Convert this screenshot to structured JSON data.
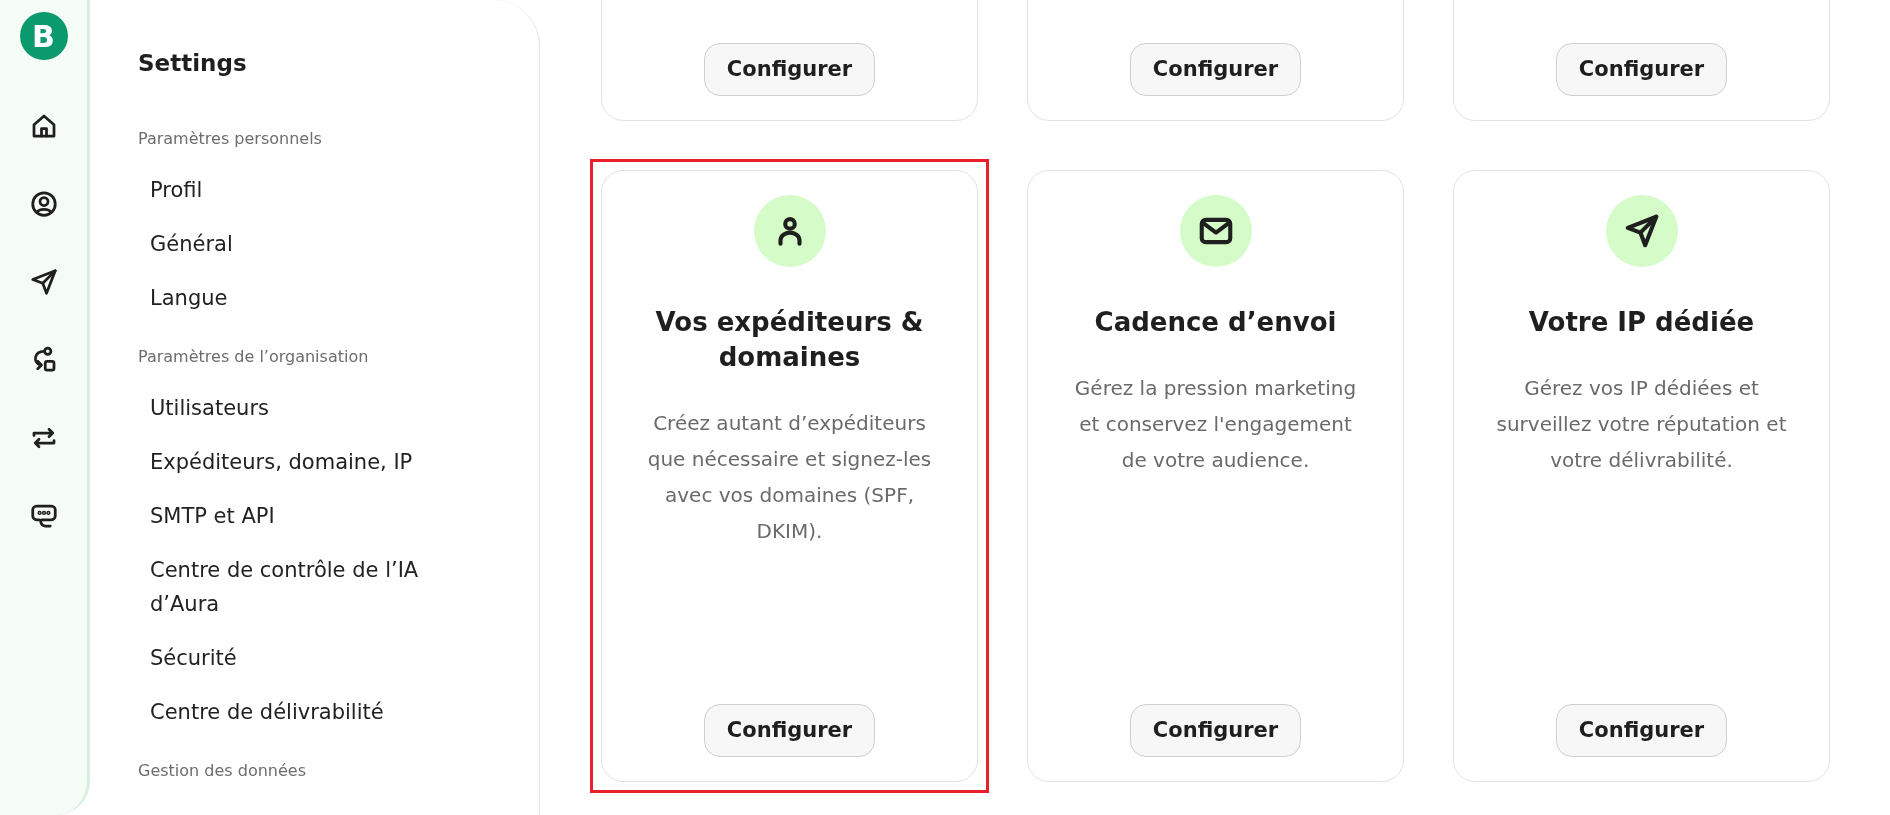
{
  "rail": {
    "logo": "B",
    "items": [
      {
        "kind": "home"
      },
      {
        "kind": "account"
      },
      {
        "kind": "send"
      },
      {
        "kind": "automation"
      },
      {
        "kind": "transfer"
      },
      {
        "kind": "chat"
      }
    ]
  },
  "sidebar": {
    "title": "Settings",
    "sections": [
      {
        "heading": "Paramètres personnels",
        "items": [
          "Profil",
          "Général",
          "Langue"
        ]
      },
      {
        "heading": "Paramètres de l’organisation",
        "items": [
          "Utilisateurs",
          "Expéditeurs, domaine, IP",
          "SMTP et API",
          "Centre de contrôle de l’IA d’Aura",
          "Sécurité",
          "Centre de délivrabilité"
        ]
      },
      {
        "heading": "Gestion des données"
      }
    ]
  },
  "top_cards": [
    {
      "button": "Configurer"
    },
    {
      "button": "Configurer"
    },
    {
      "button": "Configurer"
    }
  ],
  "cards": [
    {
      "kind": "senders",
      "title": "Vos expéditeurs & domaines",
      "description": "Créez autant d’expéditeurs que nécessaire et signez-les avec vos domaines (SPF, DKIM).",
      "button": "Configurer",
      "highlighted": true
    },
    {
      "kind": "cadence",
      "title": "Cadence d’envoi",
      "description": "Gérez la pression marketing et conservez l'engagement de votre audience.",
      "button": "Configurer",
      "highlighted": false
    },
    {
      "kind": "dedicated_ip",
      "title": "Votre IP dédiée",
      "description": "Gérez vos IP dédiées et surveillez votre réputation et votre délivrabilité.",
      "button": "Configurer",
      "highlighted": false
    }
  ]
}
